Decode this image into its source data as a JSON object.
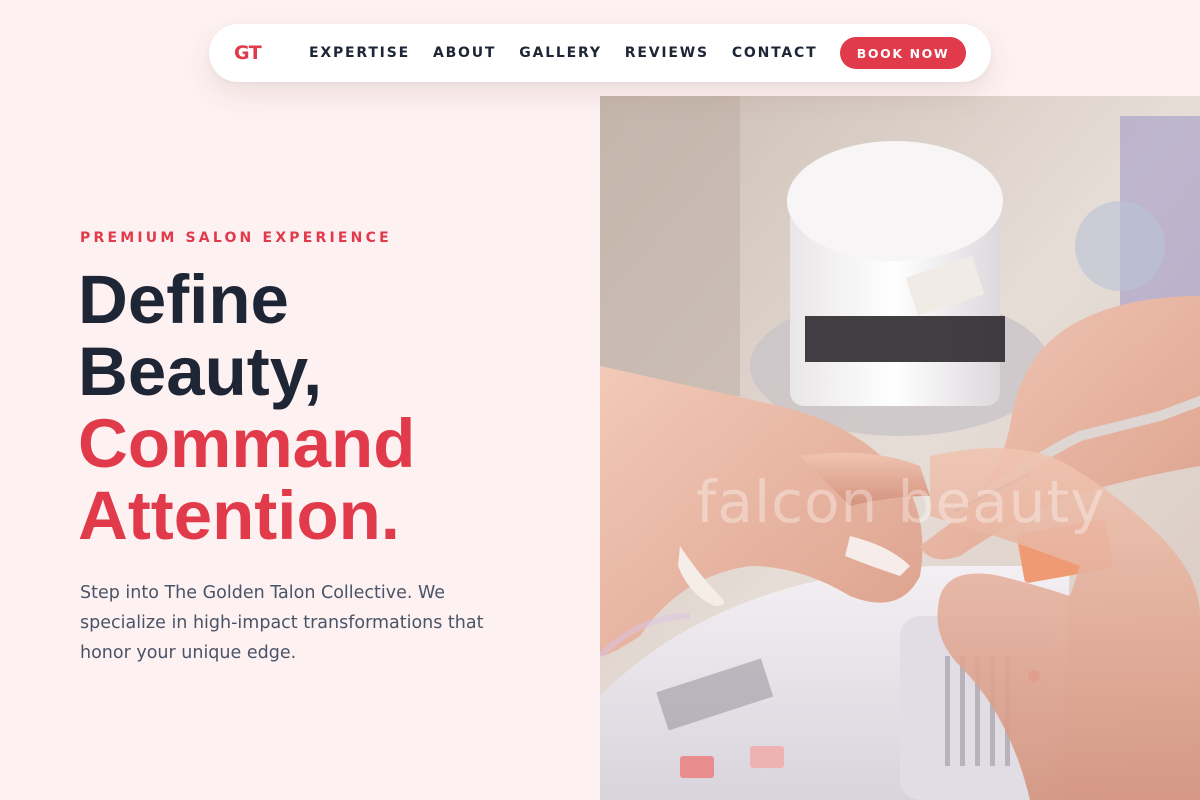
{
  "nav": {
    "logo": "GT",
    "items": [
      "EXPERTISE",
      "ABOUT",
      "GALLERY",
      "REVIEWS",
      "CONTACT"
    ],
    "cta": "BOOK NOW"
  },
  "hero": {
    "eyebrow": "PREMIUM SALON EXPERIENCE",
    "headline": {
      "line1": "Define",
      "line2": "Beauty,",
      "line3": "Command",
      "line4": "Attention."
    },
    "description": "Step into The Golden Talon Collective. We specialize in high-impact transformations that honor your unique edge.",
    "image_watermark": "falcon beauty"
  },
  "colors": {
    "accent": "#e03a4b",
    "text_dark": "#1e2535",
    "text_body": "#4a5468",
    "background": "#fdf1f1"
  }
}
